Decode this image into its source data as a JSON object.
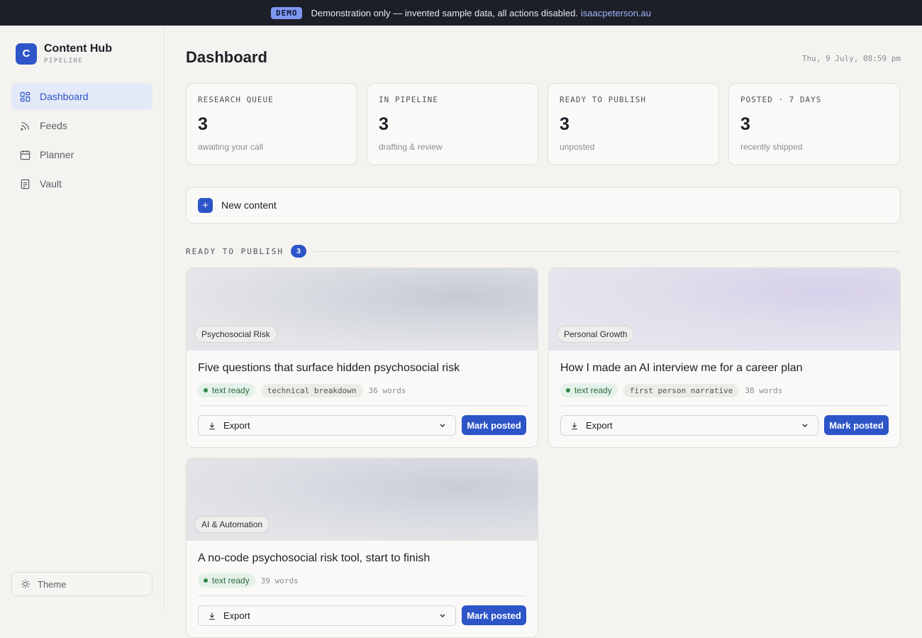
{
  "banner": {
    "badge": "DEMO",
    "text": "Demonstration only — invented sample data, all actions disabled.",
    "link": "isaacpeterson.au"
  },
  "brand": {
    "logo": "C",
    "name": "Content Hub",
    "sub": "PIPELINE"
  },
  "nav": [
    {
      "label": "Dashboard",
      "icon": "dashboard-icon",
      "active": true
    },
    {
      "label": "Feeds",
      "icon": "rss-icon"
    },
    {
      "label": "Planner",
      "icon": "calendar-icon"
    },
    {
      "label": "Vault",
      "icon": "document-icon"
    }
  ],
  "theme_label": "Theme",
  "page": {
    "title": "Dashboard",
    "date": "Thu, 9 July, 08:59 pm"
  },
  "stats": [
    {
      "label": "RESEARCH QUEUE",
      "value": "3",
      "sub": "awaiting your call"
    },
    {
      "label": "IN PIPELINE",
      "value": "3",
      "sub": "drafting & review"
    },
    {
      "label": "READY TO PUBLISH",
      "value": "3",
      "sub": "unposted"
    },
    {
      "label": "POSTED · 7 DAYS",
      "value": "3",
      "sub": "recently shipped"
    }
  ],
  "new_content": {
    "plus": "+",
    "label": "New content"
  },
  "section": {
    "label": "READY TO PUBLISH",
    "count": "3"
  },
  "cards": [
    {
      "tag": "Psychosocial Risk",
      "title": "Five questions that surface hidden psychosocial risk",
      "status": "text ready",
      "style": "technical breakdown",
      "words": "36 words",
      "export": "Export",
      "mark": "Mark posted"
    },
    {
      "tag": "Personal Growth",
      "title": "How I made an AI interview me for a career plan",
      "status": "text ready",
      "style": "first person narrative",
      "words": "38 words",
      "export": "Export",
      "mark": "Mark posted"
    },
    {
      "tag": "AI & Automation",
      "title": "A no-code psychosocial risk tool, start to finish",
      "status": "text ready",
      "style": "",
      "words": "39 words",
      "export": "Export",
      "mark": "Mark posted"
    }
  ],
  "colors": {
    "accent": "#2d55c8",
    "banner_bg": "#1c1f27",
    "ready_green": "#2f8a4c"
  }
}
